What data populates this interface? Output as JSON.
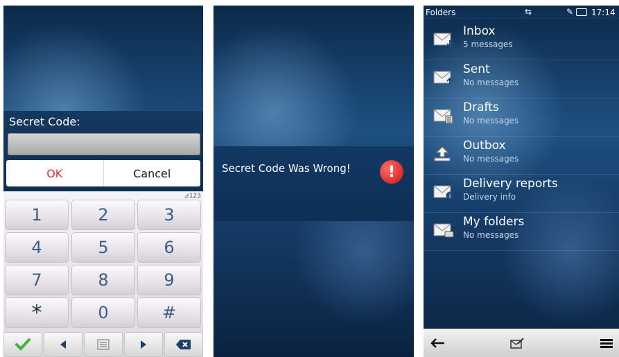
{
  "screen1": {
    "label": "Secret Code:",
    "input_value": "",
    "ok": "OK",
    "cancel": "Cancel",
    "mode": "123",
    "keys": [
      "1",
      "2",
      "3",
      "4",
      "5",
      "6",
      "7",
      "8",
      "9",
      "*",
      "0",
      "#"
    ]
  },
  "screen2": {
    "message": "Secret Code Was Wrong!",
    "icon": "!"
  },
  "screen3": {
    "title": "Folders",
    "time": "17:14",
    "folders": [
      {
        "name": "Inbox",
        "sub": "5 messages",
        "icon": "inbox-icon"
      },
      {
        "name": "Sent",
        "sub": "No messages",
        "icon": "sent-icon"
      },
      {
        "name": "Drafts",
        "sub": "No messages",
        "icon": "drafts-icon"
      },
      {
        "name": "Outbox",
        "sub": "No messages",
        "icon": "outbox-icon"
      },
      {
        "name": "Delivery reports",
        "sub": "Delivery info",
        "icon": "delivery-reports-icon"
      },
      {
        "name": "My folders",
        "sub": "No messages",
        "icon": "my-folders-icon"
      }
    ]
  },
  "colors": {
    "ok": "#e03030",
    "key_text": "#3d5e84",
    "alert": "#cc1111",
    "confirm_check": "#3cb33c"
  }
}
